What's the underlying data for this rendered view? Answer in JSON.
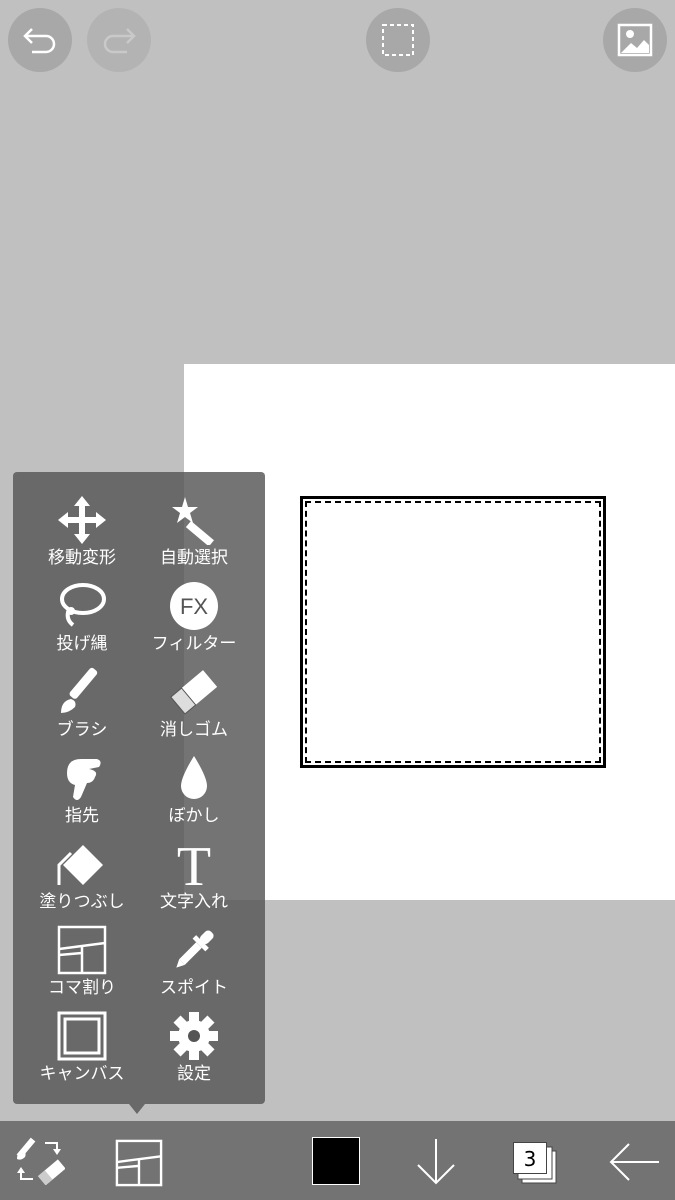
{
  "top_bar": {
    "undo_icon": "undo-arrow-icon",
    "redo_icon": "redo-arrow-icon",
    "selection_icon": "dashed-selection-icon",
    "gallery_icon": "image-gallery-icon"
  },
  "tool_menu": {
    "tools": [
      {
        "label": "移動変形",
        "icon": "move-arrows-icon"
      },
      {
        "label": "自動選択",
        "icon": "magic-wand-icon"
      },
      {
        "label": "投げ縄",
        "icon": "lasso-icon"
      },
      {
        "label": "フィルター",
        "icon": "fx-icon",
        "glyph": "FX"
      },
      {
        "label": "ブラシ",
        "icon": "brush-icon"
      },
      {
        "label": "消しゴム",
        "icon": "eraser-icon"
      },
      {
        "label": "指先",
        "icon": "finger-icon"
      },
      {
        "label": "ぼかし",
        "icon": "drop-icon"
      },
      {
        "label": "塗りつぶし",
        "icon": "fill-bucket-icon"
      },
      {
        "label": "文字入れ",
        "icon": "text-icon",
        "glyph": "T"
      },
      {
        "label": "コマ割り",
        "icon": "panel-layout-icon"
      },
      {
        "label": "スポイト",
        "icon": "eyedropper-icon"
      },
      {
        "label": "キャンバス",
        "icon": "canvas-icon"
      },
      {
        "label": "設定",
        "icon": "gear-icon"
      }
    ]
  },
  "bottom_bar": {
    "tool_switch_icon": "brush-eraser-switch-icon",
    "panel_icon": "panel-layout-icon",
    "color": "#000000",
    "download_icon": "down-arrow-icon",
    "layer_count": "3",
    "back_icon": "back-arrow-icon"
  }
}
